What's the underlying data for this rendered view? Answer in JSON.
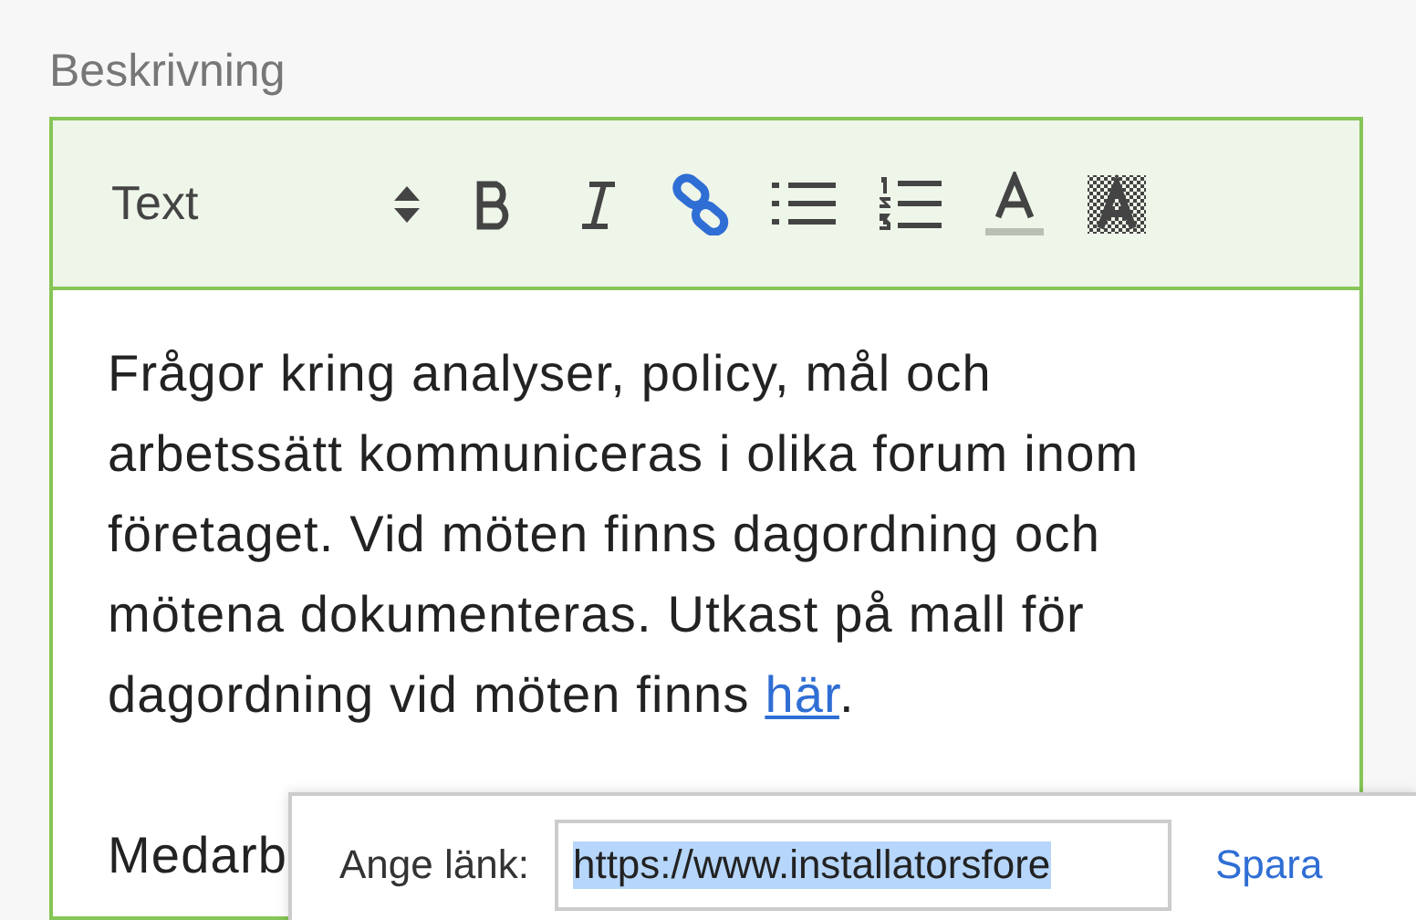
{
  "field_label": "Beskrivning",
  "toolbar": {
    "format_select": "Text",
    "buttons": [
      {
        "kind": "bold",
        "active": false
      },
      {
        "kind": "italic",
        "active": false
      },
      {
        "kind": "link",
        "active": true
      },
      {
        "kind": "bullet-list",
        "active": false
      },
      {
        "kind": "numbered-list",
        "active": false
      },
      {
        "kind": "text-color",
        "active": false
      },
      {
        "kind": "highlight",
        "active": false
      }
    ]
  },
  "content": {
    "paragraphs": [
      {
        "text": "Frågor kring analyser, policy, mål och arbetssätt kommuniceras i olika forum inom företaget. Vid möten finns dagordning och mötena dokumenteras. Utkast på mall för dagordning vid möten finns ",
        "link": "här",
        "after": "."
      },
      {
        "text": "Medarb"
      }
    ]
  },
  "link_popup": {
    "label": "Ange länk:",
    "value": "https://www.installatorsfore",
    "save": "Spara"
  }
}
